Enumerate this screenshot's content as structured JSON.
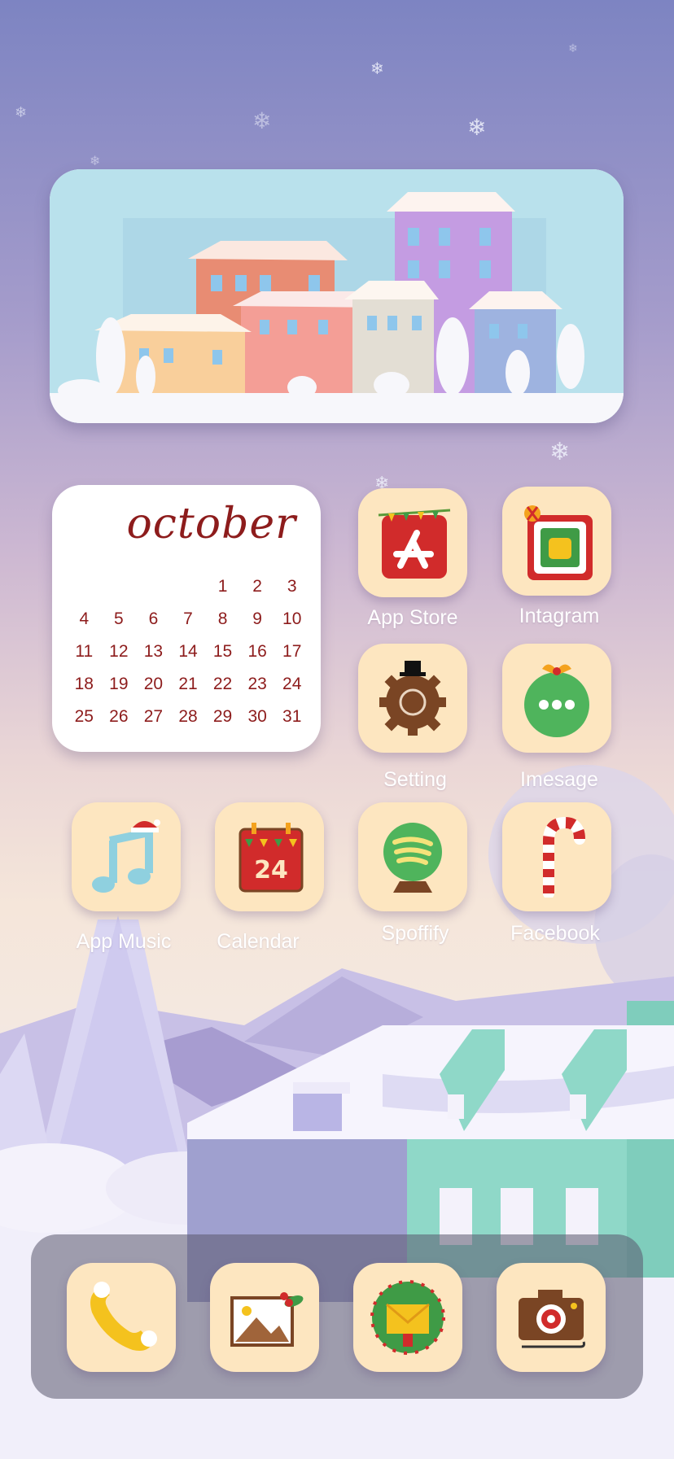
{
  "calendar": {
    "month": "october",
    "days": [
      "",
      "",
      "",
      "",
      "1",
      "2",
      "3",
      "4",
      "5",
      "6",
      "7",
      "8",
      "9",
      "10",
      "11",
      "12",
      "13",
      "14",
      "15",
      "16",
      "17",
      "18",
      "19",
      "20",
      "21",
      "22",
      "23",
      "24",
      "25",
      "26",
      "27",
      "28",
      "29",
      "30",
      "31"
    ]
  },
  "apps": {
    "app_store": "App Store",
    "instagram": "Intagram",
    "settings": "Setting",
    "imessage": "Imesage",
    "music": "App Music",
    "calendar": "Calendar",
    "spotify": "Spoffify",
    "facebook": "Facebook",
    "calendar_icon_day": "24"
  },
  "dock": {
    "icons": [
      "phone-icon",
      "photos-icon",
      "mail-icon",
      "camera-icon"
    ]
  },
  "colors": {
    "icon_bg": "#fde6c0",
    "calendar_text": "#8d1c1c",
    "label_text": "#ffffff"
  }
}
